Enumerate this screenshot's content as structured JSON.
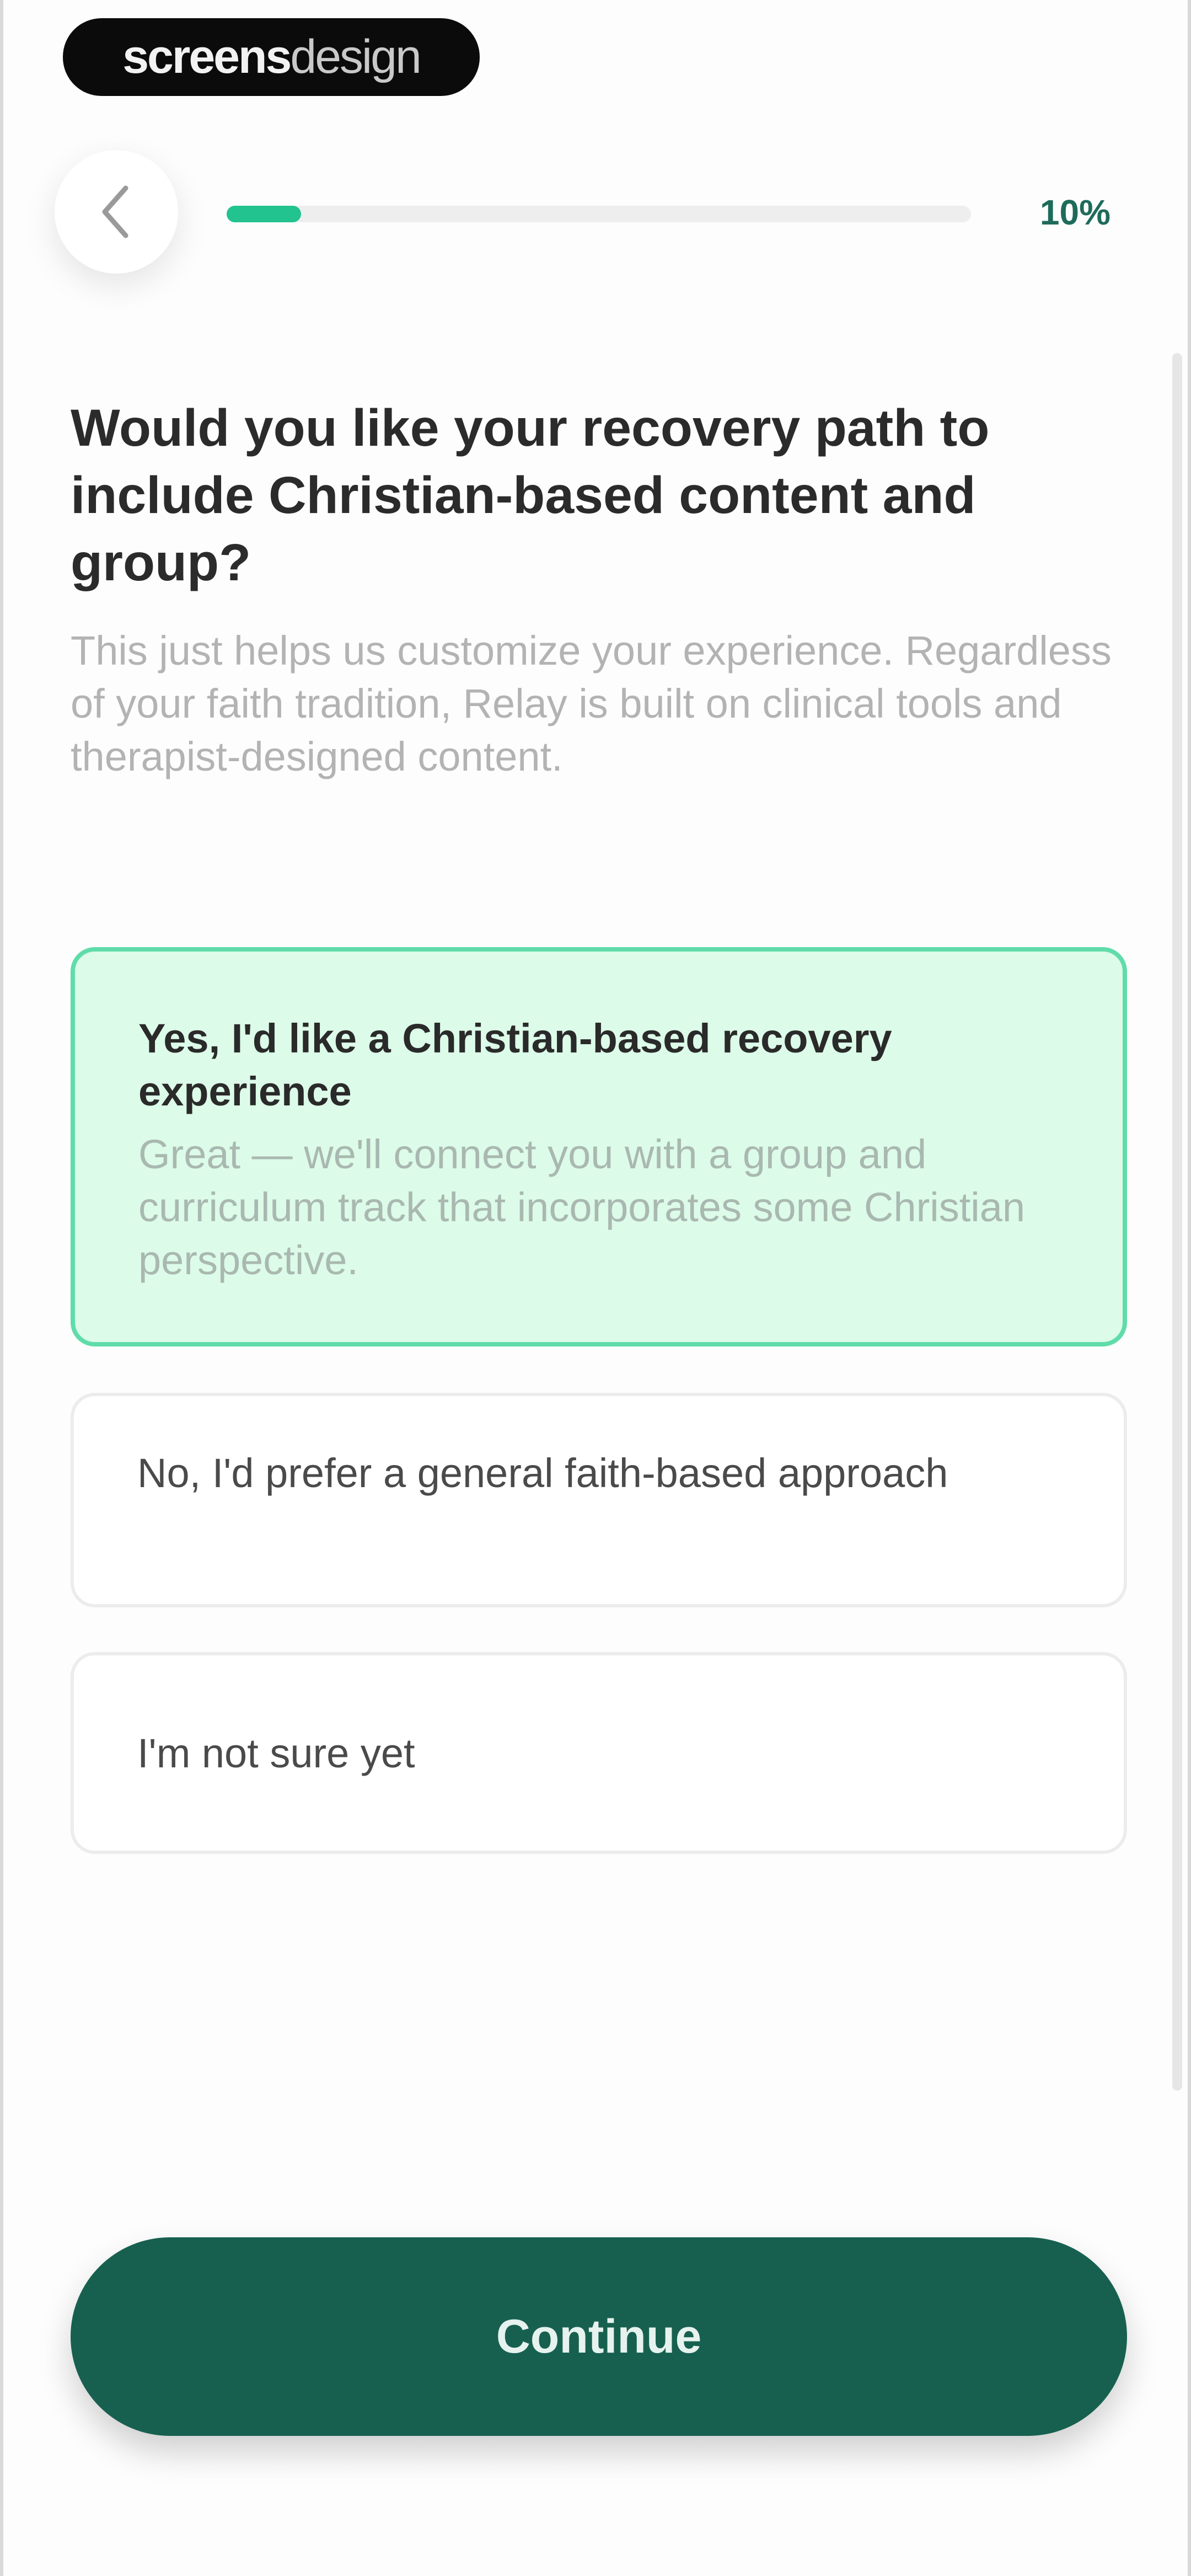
{
  "watermark": {
    "bold": "screens",
    "light": "design"
  },
  "header": {
    "progress_value": 0.1,
    "progress_label": "10%"
  },
  "question": {
    "title": "Would you like your recovery path to include Christian-based content and group?",
    "subtitle": "This just helps us customize your experience. Regardless of your faith tradition, Relay is built on clinical tools and therapist-designed content."
  },
  "options": [
    {
      "label": "Yes, I'd like a Christian-based recovery experience",
      "description": "Great — we'll connect you with a group and curriculum track that incorporates some Christian perspective.",
      "selected": true
    },
    {
      "label": "No, I'd prefer a general faith-based approach",
      "selected": false
    },
    {
      "label": "I'm not sure yet",
      "selected": false
    }
  ],
  "footer": {
    "continue_label": "Continue"
  },
  "colors": {
    "accent": "#22c38e",
    "primary_button": "#17604f",
    "selected_bg": "#dcfbe9",
    "selected_border": "#5fdcaa"
  },
  "icons": {
    "back": "chevron-left-icon"
  }
}
